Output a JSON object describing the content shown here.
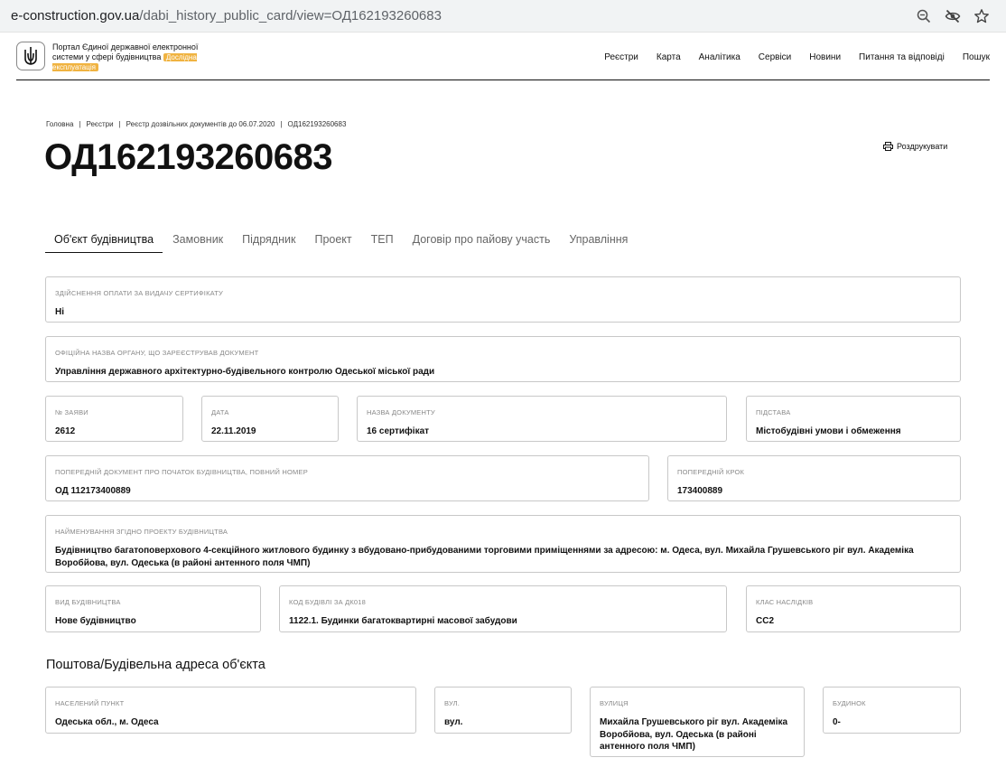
{
  "browser": {
    "url_host": "e-construction.gov.ua",
    "url_path": "/dabi_history_public_card/view=ОД162193260683"
  },
  "header": {
    "portal_title": "Портал Єдиної державної електронної системи у сфері будівництва",
    "badge": "Дослідна експлуатація",
    "nav": [
      "Реєстри",
      "Карта",
      "Аналітика",
      "Сервіси",
      "Новини",
      "Питання та відповіді",
      "Пошук"
    ]
  },
  "breadcrumb": [
    "Головна",
    "Реєстри",
    "Реєстр дозвільних документів до 06.07.2020",
    "ОД162193260683"
  ],
  "title": "ОД162193260683",
  "print_label": "Роздрукувати",
  "tabs": [
    "Об'єкт будівництва",
    "Замовник",
    "Підрядник",
    "Проект",
    "ТЕП",
    "Договір про пайову участь",
    "Управління"
  ],
  "fields": {
    "payment": {
      "label": "Здійснення оплати за видачу сертифікату",
      "value": "Ні"
    },
    "authority": {
      "label": "Офіційна назва органу, що зареєстрував документ",
      "value": "Управління державного архітектурно-будівельного контролю Одеської міської ради"
    },
    "app_no": {
      "label": "№ заяви",
      "value": "2612"
    },
    "date": {
      "label": "Дата",
      "value": "22.11.2019"
    },
    "doc_name": {
      "label": "Назва документу",
      "value": "16 сертифікат"
    },
    "basis": {
      "label": "Підстава",
      "value": "Містобудівні умови і обмеження"
    },
    "prev_doc": {
      "label": "Попередній документ про початок будівництва, повний номер",
      "value": "ОД 112173400889"
    },
    "prev_step": {
      "label": "Попередній крок",
      "value": "173400889"
    },
    "project_name": {
      "label": "Найменування згідно проекту будівництва",
      "value": "Будівництво багатоповерхового 4-секційного житлового будинку з вбудовано-прибудованими торговими приміщеннями за адресою: м. Одеса, вул. Михайла Грушевського ріг вул. Академіка Воробйова, вул. Одеська (в районі антенного поля ЧМП)"
    },
    "build_type": {
      "label": "Вид будівництва",
      "value": "Нове будівництво"
    },
    "dk018": {
      "label": "Код будівлі за ДК018",
      "value": "1122.1. Будинки багатоквартирні масової забудови"
    },
    "consequence": {
      "label": "Клас наслідків",
      "value": "СС2"
    }
  },
  "address_section_title": "Поштова/Будівельна адреса об'єкта",
  "address": {
    "locality": {
      "label": "Населений пункт",
      "value": "Одеська обл., м. Одеса"
    },
    "street_type": {
      "label": "Вул.",
      "value": "вул."
    },
    "street": {
      "label": "Вулиця",
      "value": "Михайла Грушевського ріг вул. Академіка Воробйова, вул. Одеська (в районі антенного поля ЧМП)"
    },
    "building": {
      "label": "Будинок",
      "value": "0-"
    }
  }
}
